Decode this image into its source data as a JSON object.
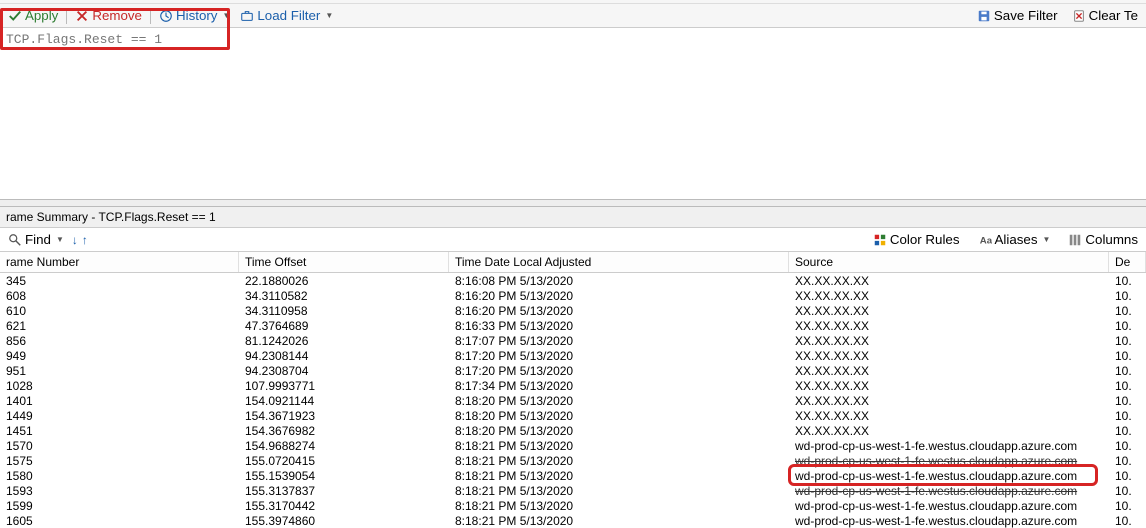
{
  "toolbar": {
    "apply": "Apply",
    "remove": "Remove",
    "history": "History",
    "load_filter": "Load Filter",
    "save_filter": "Save Filter",
    "clear": "Clear Te"
  },
  "filter_expression": "TCP.Flags.Reset == 1",
  "summary": {
    "title": "rame Summary - TCP.Flags.Reset == 1"
  },
  "findbar": {
    "find": "Find",
    "color_rules": "Color Rules",
    "aliases": "Aliases",
    "columns": "Columns"
  },
  "columns": {
    "frame": "rame Number",
    "offset": "Time Offset",
    "tdla": "Time Date Local Adjusted",
    "source": "Source",
    "dest": "De"
  },
  "rows": [
    {
      "f": "345",
      "o": "22.1880026",
      "t": "8:16:08 PM 5/13/2020",
      "s": "XX.XX.XX.XX",
      "d": "10."
    },
    {
      "f": "608",
      "o": "34.3110582",
      "t": "8:16:20 PM 5/13/2020",
      "s": "XX.XX.XX.XX",
      "d": "10."
    },
    {
      "f": "610",
      "o": "34.3110958",
      "t": "8:16:20 PM 5/13/2020",
      "s": "XX.XX.XX.XX",
      "d": "10."
    },
    {
      "f": "621",
      "o": "47.3764689",
      "t": "8:16:33 PM 5/13/2020",
      "s": "XX.XX.XX.XX",
      "d": "10."
    },
    {
      "f": "856",
      "o": "81.1242026",
      "t": "8:17:07 PM 5/13/2020",
      "s": "XX.XX.XX.XX",
      "d": "10."
    },
    {
      "f": "949",
      "o": "94.2308144",
      "t": "8:17:20 PM 5/13/2020",
      "s": "XX.XX.XX.XX",
      "d": "10."
    },
    {
      "f": "951",
      "o": "94.2308704",
      "t": "8:17:20 PM 5/13/2020",
      "s": "XX.XX.XX.XX",
      "d": "10."
    },
    {
      "f": "1028",
      "o": "107.9993771",
      "t": "8:17:34 PM 5/13/2020",
      "s": "XX.XX.XX.XX",
      "d": "10."
    },
    {
      "f": "1401",
      "o": "154.0921144",
      "t": "8:18:20 PM 5/13/2020",
      "s": "XX.XX.XX.XX",
      "d": "10."
    },
    {
      "f": "1449",
      "o": "154.3671923",
      "t": "8:18:20 PM 5/13/2020",
      "s": "XX.XX.XX.XX",
      "d": "10."
    },
    {
      "f": "1451",
      "o": "154.3676982",
      "t": "8:18:20 PM 5/13/2020",
      "s": "XX.XX.XX.XX",
      "d": "10."
    },
    {
      "f": "1570",
      "o": "154.9688274",
      "t": "8:18:21 PM 5/13/2020",
      "s": "wd-prod-cp-us-west-1-fe.westus.cloudapp.azure.com",
      "d": "10."
    },
    {
      "f": "1575",
      "o": "155.0720415",
      "t": "8:18:21 PM 5/13/2020",
      "s": "wd-prod-cp-us-west-1-fe.westus.cloudapp.azure.com",
      "d": "10.",
      "strike": true
    },
    {
      "f": "1580",
      "o": "155.1539054",
      "t": "8:18:21 PM 5/13/2020",
      "s": "wd-prod-cp-us-west-1-fe.westus.cloudapp.azure.com",
      "d": "10.",
      "highlight": true
    },
    {
      "f": "1593",
      "o": "155.3137837",
      "t": "8:18:21 PM 5/13/2020",
      "s": "wd-prod-cp-us-west-1-fe.westus.cloudapp.azure.com",
      "d": "10.",
      "strike": true
    },
    {
      "f": "1599",
      "o": "155.3170442",
      "t": "8:18:21 PM 5/13/2020",
      "s": "wd-prod-cp-us-west-1-fe.westus.cloudapp.azure.com",
      "d": "10."
    },
    {
      "f": "1605",
      "o": "155.3974860",
      "t": "8:18:21 PM 5/13/2020",
      "s": "wd-prod-cp-us-west-1-fe.westus.cloudapp.azure.com",
      "d": "10."
    }
  ]
}
